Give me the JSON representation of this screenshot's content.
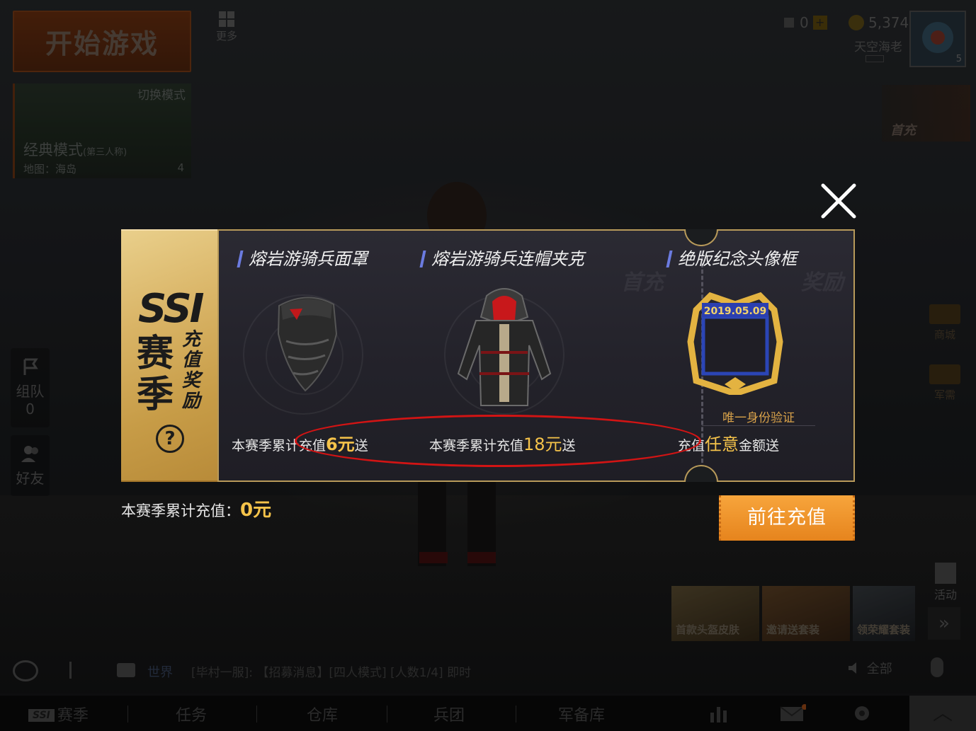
{
  "lobby": {
    "start_game": "开始游戏",
    "more": "更多",
    "mode_switch": "切换模式",
    "mode_name": "经典模式",
    "mode_sub": "(第三人称)",
    "map": "地图：海岛",
    "team_size": "4",
    "currency_value": "0",
    "bp_value": "5,374",
    "username": "天空海老",
    "level": "5",
    "first_charge": "首充",
    "team_label": "组队",
    "team_count": "0",
    "friends_label": "好友",
    "shop_label": "商城",
    "supply_label": "军需",
    "activity_label": "活动"
  },
  "banners": [
    {
      "label": "首款头盔皮肤"
    },
    {
      "label": "邀请送套装"
    },
    {
      "label": "领荣耀套装"
    }
  ],
  "chat": {
    "channel": "世界",
    "message": "[毕村一服]: 【招募消息】[四人模式] [人数1/4] 即时",
    "all": "全部"
  },
  "nav": {
    "season_badge": "SSI",
    "season": "赛季",
    "tasks": "任务",
    "warehouse": "仓库",
    "corps": "兵团",
    "armory": "军备库"
  },
  "modal": {
    "ssi": "SSI",
    "season": "赛季",
    "reward": "充值奖励",
    "help": "?",
    "items": [
      {
        "title": "熔岩游骑兵面罩",
        "prefix": "本赛季累计充值",
        "amount": "6元",
        "suffix": "送"
      },
      {
        "title": "熔岩游骑兵连帽夹克",
        "prefix": "本赛季累计充值",
        "amount": "18元",
        "suffix": "送"
      },
      {
        "title": "绝版纪念头像框",
        "frame_date": "2019.05.09",
        "identity": "唯一身份验证",
        "prefix": "充值",
        "amount": "任意",
        "suffix": "金额送"
      }
    ],
    "watermark_left": "首充",
    "watermark_right": "奖励",
    "total_label": "本赛季累计充值：",
    "total_value": "0元",
    "go_charge": "前往充值"
  },
  "colors": {
    "accent_gold": "#f5c34a",
    "button_orange": "#f39a2f",
    "highlight_red": "#d21414",
    "title_bar_blue": "#6b7be0"
  }
}
